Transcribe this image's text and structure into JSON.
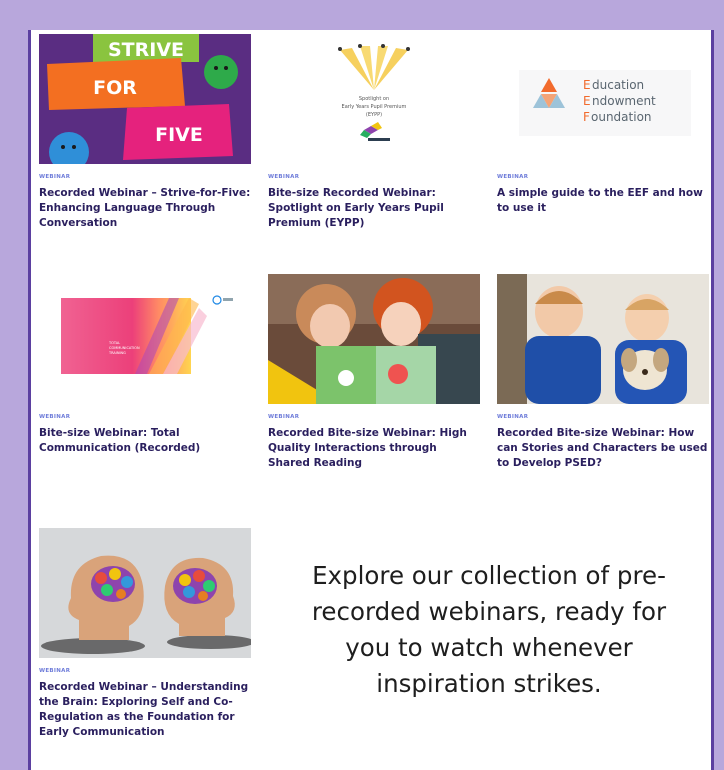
{
  "cards": [
    {
      "tag": "WEBINAR",
      "title": "Recorded Webinar – Strive-for-Five: Enhancing Language Through Conversation",
      "thumb_words": [
        "STRIVE",
        "FOR",
        "FIVE"
      ]
    },
    {
      "tag": "WEBINAR",
      "title": "Bite-size Recorded Webinar: Spotlight on Early Years Pupil Premium (EYPP)",
      "thumb_text": [
        "Spotlight on",
        "Early Years Pupil Premium",
        "(EYPP)"
      ]
    },
    {
      "tag": "WEBINAR",
      "title": "A simple guide to the EEF and how to use it",
      "thumb_lines": [
        "ducation",
        "ndowment",
        "oundation"
      ],
      "thumb_initials": [
        "E",
        "E",
        "F"
      ]
    },
    {
      "tag": "WEBINAR",
      "title": "Bite-size Webinar: Total Communication (Recorded)",
      "thumb_text": [
        "TOTAL",
        "COMMUNICATION",
        "TRAINING"
      ]
    },
    {
      "tag": "WEBINAR",
      "title": "Recorded Bite-size Webinar: High Quality Interactions through Shared Reading"
    },
    {
      "tag": "WEBINAR",
      "title": "Recorded Bite-size Webinar: How can Stories and Characters be used to Develop PSED?"
    },
    {
      "tag": "WEBINAR",
      "title": "Recorded Webinar – Understanding the Brain: Exploring Self and Co-Regulation as the Foundation for Early Communication"
    }
  ],
  "explore_lines": [
    "Explore our collection of pre-",
    "recorded webinars, ready for",
    "you to watch whenever",
    "inspiration strikes."
  ],
  "colors": {
    "background": "#b8a7dc",
    "frame_border": "#5b3fa0",
    "tag": "#6d7bd9",
    "title": "#2a1f5e"
  }
}
